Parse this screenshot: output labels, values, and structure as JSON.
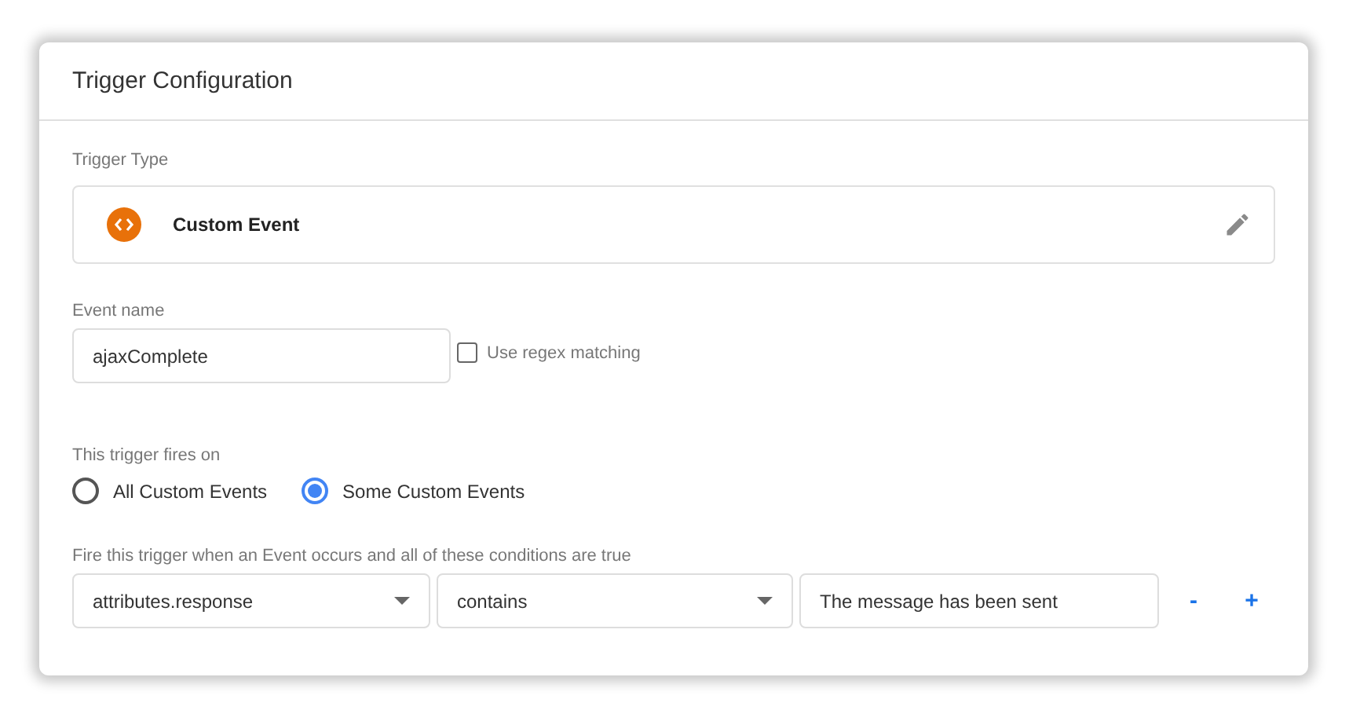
{
  "title": "Trigger Configuration",
  "trigger_type": {
    "label": "Trigger Type",
    "name": "Custom Event"
  },
  "event_name": {
    "label": "Event name",
    "value": "ajaxComplete",
    "regex": {
      "label": "Use regex matching",
      "checked": false
    }
  },
  "fires_on": {
    "label": "This trigger fires on",
    "options": [
      {
        "label": "All Custom Events",
        "selected": false
      },
      {
        "label": "Some Custom Events",
        "selected": true
      }
    ]
  },
  "conditions": {
    "label": "Fire this trigger when an Event occurs and all of these conditions are true",
    "rows": [
      {
        "variable": "attributes.response",
        "operator": "contains",
        "value": "The message has been sent",
        "remove": "-",
        "add": "+"
      }
    ]
  }
}
